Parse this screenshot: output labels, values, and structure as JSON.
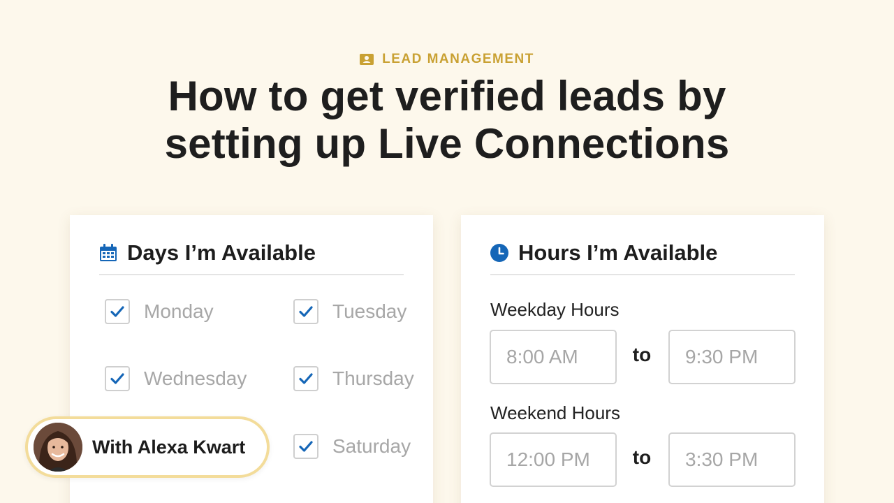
{
  "eyebrow": {
    "label": "LEAD MANAGEMENT",
    "icon": "contact-card-icon",
    "color": "#c9a133"
  },
  "title": {
    "line1": "How to get verified leads by",
    "line2": "setting up Live Connections"
  },
  "days_card": {
    "heading": "Days I’m Available",
    "icon": "calendar-icon",
    "days": [
      {
        "label": "Monday",
        "checked": true
      },
      {
        "label": "Tuesday",
        "checked": true
      },
      {
        "label": "Wednesday",
        "checked": true
      },
      {
        "label": "Thursday",
        "checked": true
      },
      {
        "label": "Saturday",
        "checked": true
      }
    ]
  },
  "hours_card": {
    "heading": "Hours I’m Available",
    "icon": "clock-icon",
    "weekday": {
      "label": "Weekday Hours",
      "start": "8:00 AM",
      "to": "to",
      "end": "9:30 PM"
    },
    "weekend": {
      "label": "Weekend Hours",
      "start": "12:00 PM",
      "to": "to",
      "end": "3:30 PM"
    }
  },
  "host": {
    "name": "With Alexa Kwart",
    "avatar": "presenter-avatar"
  },
  "colors": {
    "accent_blue": "#1566b7",
    "background": "#fdf8ec",
    "pill_border": "#f3dc9a"
  }
}
